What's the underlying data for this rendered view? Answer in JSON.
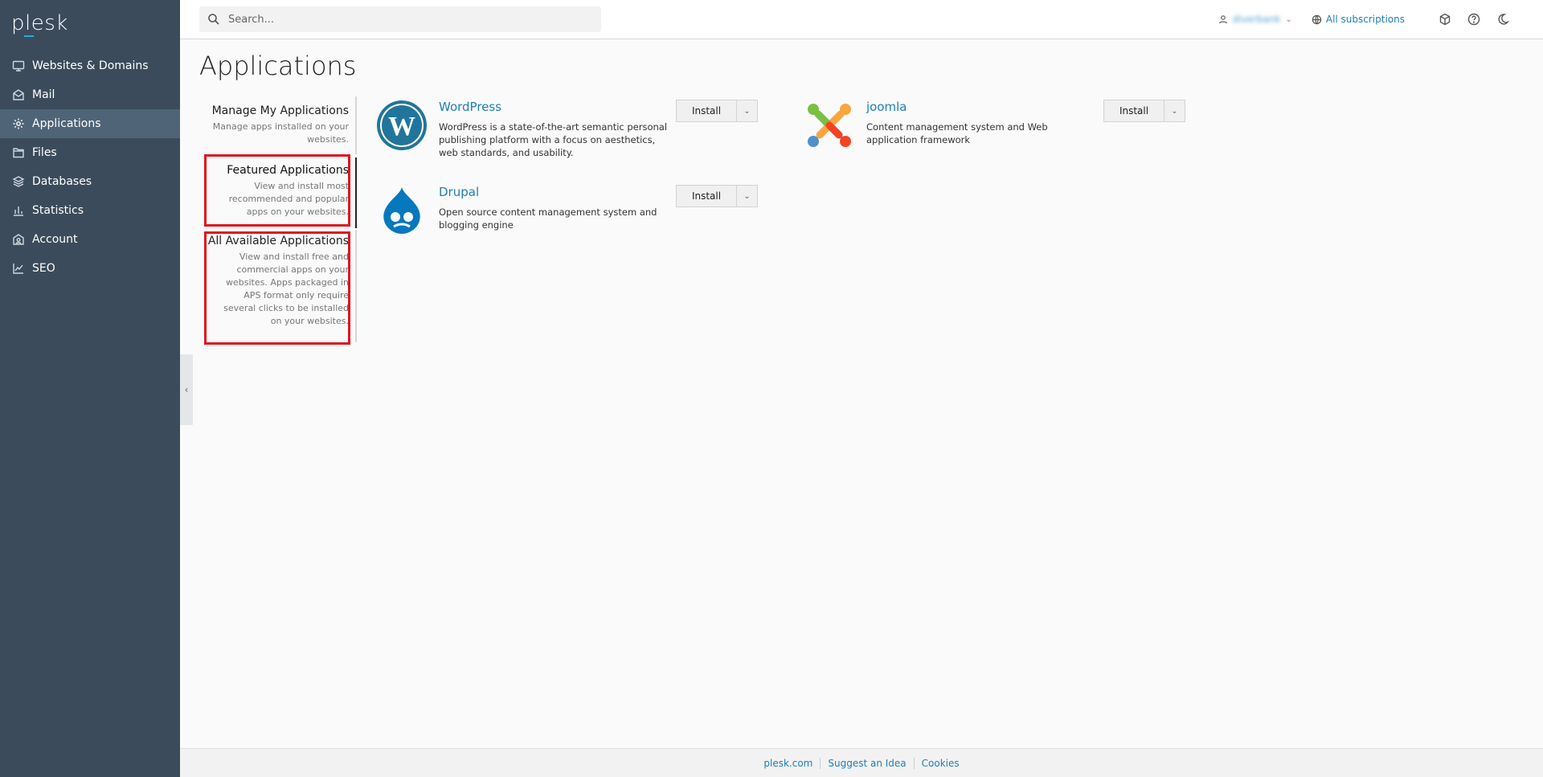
{
  "brand": {
    "logo_text": "plesk"
  },
  "sidebar": {
    "items": [
      {
        "label": "Websites & Domains",
        "icon": "monitor-icon"
      },
      {
        "label": "Mail",
        "icon": "mail-icon"
      },
      {
        "label": "Applications",
        "icon": "gear-icon",
        "active": true
      },
      {
        "label": "Files",
        "icon": "folder-icon"
      },
      {
        "label": "Databases",
        "icon": "database-icon"
      },
      {
        "label": "Statistics",
        "icon": "bar-chart-icon"
      },
      {
        "label": "Account",
        "icon": "account-icon"
      },
      {
        "label": "SEO",
        "icon": "trend-icon"
      }
    ]
  },
  "header": {
    "search_placeholder": "Search...",
    "username": "diverbank",
    "subscriptions_label": "All subscriptions"
  },
  "page": {
    "title": "Applications"
  },
  "tabs": [
    {
      "title": "Manage My Applications",
      "desc": "Manage apps installed on your websites."
    },
    {
      "title": "Featured Applications",
      "desc": "View and install most recommended and popular apps on your websites.",
      "active": true
    },
    {
      "title": "All Available Applications",
      "desc": "View and install free and commercial apps on your websites. Apps packaged in APS format only require several clicks to be installed on your websites."
    }
  ],
  "apps": [
    {
      "name": "WordPress",
      "desc": "WordPress is a state-of-the-art semantic personal publishing platform with a focus on aesthetics, web standards, and usability.",
      "button": "Install"
    },
    {
      "name": "joomla",
      "desc": "Content management system and Web application framework",
      "button": "Install"
    },
    {
      "name": "Drupal",
      "desc": "Open source content management system and blogging engine",
      "button": "Install"
    }
  ],
  "footer": {
    "links": [
      "plesk.com",
      "Suggest an Idea",
      "Cookies"
    ]
  },
  "colors": {
    "sidebar_bg": "#3b4b5b",
    "link": "#1e7fb8",
    "highlight": "#e0141e"
  }
}
